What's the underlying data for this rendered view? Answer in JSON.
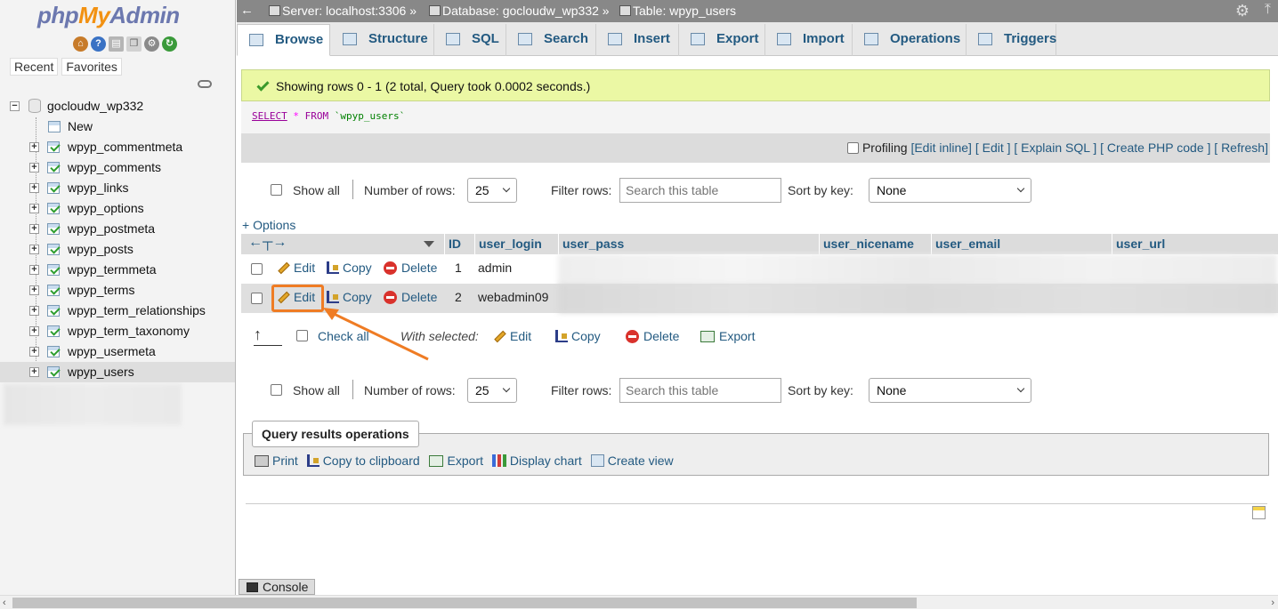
{
  "nav": {
    "logo_php": "php",
    "logo_my": "My",
    "logo_admin": "Admin",
    "quick_icons": [
      "home-icon",
      "help-icon",
      "docs-icon",
      "copy-icon",
      "settings-icon",
      "reload-icon"
    ],
    "tabs": [
      "Recent",
      "Favorites"
    ],
    "database": "gocloudw_wp332",
    "new_label": "New",
    "tables": [
      "wpyp_commentmeta",
      "wpyp_comments",
      "wpyp_links",
      "wpyp_options",
      "wpyp_postmeta",
      "wpyp_posts",
      "wpyp_termmeta",
      "wpyp_terms",
      "wpyp_term_relationships",
      "wpyp_term_taxonomy",
      "wpyp_usermeta",
      "wpyp_users"
    ],
    "selected_table": "wpyp_users"
  },
  "breadcrumb": {
    "back": "←",
    "server": "Server: localhost:3306 »",
    "database": "Database: gocloudw_wp332 »",
    "table": "Table: wpyp_users"
  },
  "tabs": [
    "Browse",
    "Structure",
    "SQL",
    "Search",
    "Insert",
    "Export",
    "Import",
    "Operations",
    "Triggers"
  ],
  "active_tab": "Browse",
  "success_message": "Showing rows 0 - 1 (2 total, Query took 0.0002 seconds.)",
  "sql": {
    "select": "SELECT",
    "star": "*",
    "from": "FROM",
    "table": "`wpyp_users`"
  },
  "profiling": {
    "label": "Profiling",
    "links": [
      "[Edit inline]",
      "[ Edit ]",
      "[ Explain SQL ]",
      "[ Create PHP code ]",
      "[ Refresh]"
    ]
  },
  "controls": {
    "show_all": "Show all",
    "number_of_rows_label": "Number of rows:",
    "number_of_rows_value": "25",
    "filter_label": "Filter rows:",
    "filter_placeholder": "Search this table",
    "sort_label": "Sort by key:",
    "sort_value": "None"
  },
  "options_link": "+ Options",
  "columns": [
    "ID",
    "user_login",
    "user_pass",
    "user_nicename",
    "user_email",
    "user_url"
  ],
  "rows": [
    {
      "id": "1",
      "user_login": "admin"
    },
    {
      "id": "2",
      "user_login": "webadmin09"
    }
  ],
  "row_actions": {
    "edit": "Edit",
    "copy": "Copy",
    "delete": "Delete"
  },
  "bulk": {
    "check_all": "Check all",
    "with_selected": "With selected:",
    "edit": "Edit",
    "copy": "Copy",
    "delete": "Delete",
    "export": "Export"
  },
  "query_results": {
    "title": "Query results operations",
    "print": "Print",
    "copy_clipboard": "Copy to clipboard",
    "export": "Export",
    "display_chart": "Display chart",
    "create_view": "Create view"
  },
  "console": "Console",
  "colors": {
    "accent": "#235a81",
    "success_bg": "#ebf8a4",
    "highlight": "#ef7c24"
  }
}
